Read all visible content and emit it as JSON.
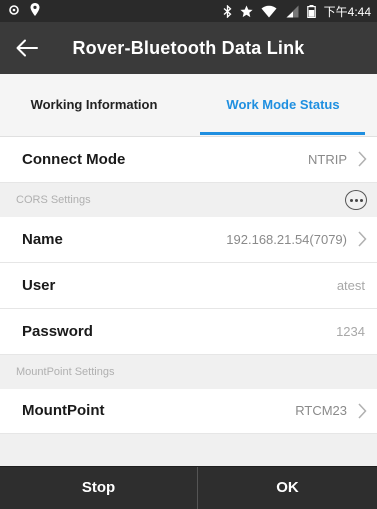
{
  "status_bar": {
    "time": "下午4:44",
    "icons": [
      "settings-icon",
      "location-icon",
      "bluetooth-icon",
      "star-icon",
      "wifi-icon",
      "signal-icon",
      "battery-icon"
    ]
  },
  "app_bar": {
    "title": "Rover-Bluetooth Data Link",
    "back_icon": "back-arrow-icon"
  },
  "tabs": [
    {
      "label": "Working Information",
      "active": false
    },
    {
      "label": "Work Mode Status",
      "active": true
    }
  ],
  "accent_color": "#1f8fe0",
  "connect_mode": {
    "label": "Connect Mode",
    "value": "NTRIP"
  },
  "cors_settings": {
    "header": "CORS Settings",
    "fields": [
      {
        "label": "Name",
        "value": "192.168.21.54(7079)"
      },
      {
        "label": "User",
        "value": "atest"
      },
      {
        "label": "Password",
        "value": "1234"
      }
    ]
  },
  "mountpoint_settings": {
    "header": "MountPoint Settings",
    "mountpoint": {
      "label": "MountPoint",
      "value": "RTCM23"
    }
  },
  "buttons": {
    "stop": "Stop",
    "ok": "OK"
  }
}
